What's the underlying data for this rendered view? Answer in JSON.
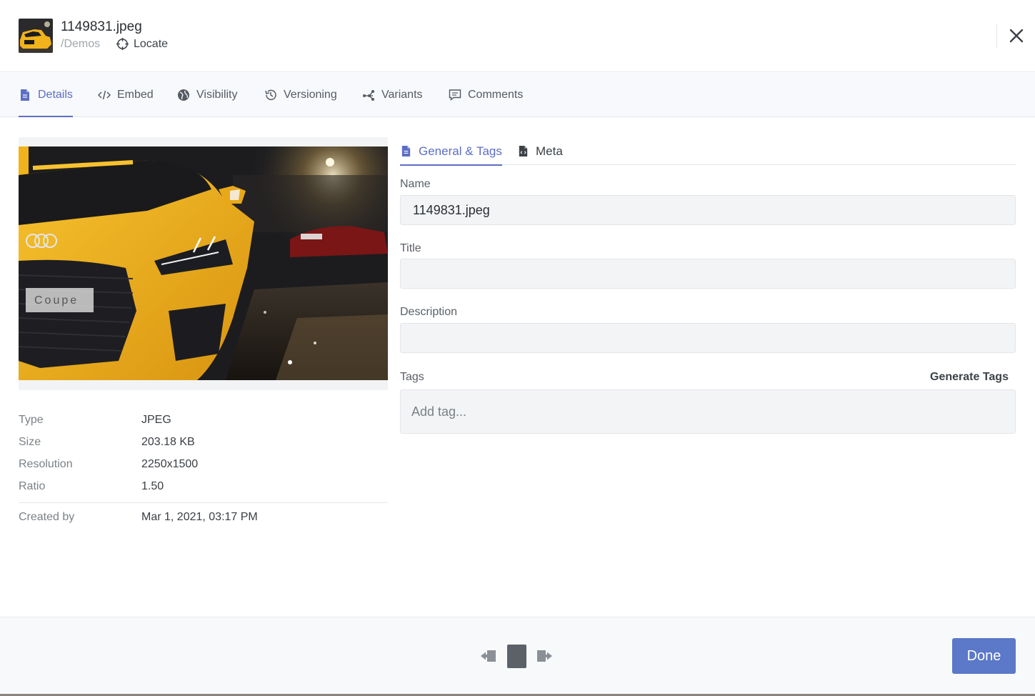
{
  "header": {
    "file_name": "1149831.jpeg",
    "folder_path": "/Demos",
    "locate_label": "Locate",
    "thumbnail_icon": "car-thumbnail",
    "close_icon": "close-icon"
  },
  "tabs": [
    {
      "label": "Details",
      "icon": "document-icon",
      "active": true
    },
    {
      "label": "Embed",
      "icon": "code-icon",
      "active": false
    },
    {
      "label": "Visibility",
      "icon": "globe-icon",
      "active": false
    },
    {
      "label": "Versioning",
      "icon": "history-icon",
      "active": false
    },
    {
      "label": "Variants",
      "icon": "variants-icon",
      "active": false
    },
    {
      "label": "Comments",
      "icon": "comment-icon",
      "active": false
    }
  ],
  "file_info": {
    "rows": [
      {
        "label": "Type",
        "value": "JPEG"
      },
      {
        "label": "Size",
        "value": "203.18 KB"
      },
      {
        "label": "Resolution",
        "value": "2250x1500"
      },
      {
        "label": "Ratio",
        "value": "1.50"
      }
    ],
    "created_label": "Created by",
    "created_value": "Mar 1, 2021, 03:17 PM"
  },
  "panel": {
    "subtabs": [
      {
        "label": "General & Tags",
        "icon": "document-icon",
        "active": true
      },
      {
        "label": "Meta",
        "icon": "code-file-icon",
        "active": false
      }
    ],
    "fields": {
      "name": {
        "label": "Name",
        "value": "1149831.jpeg"
      },
      "title": {
        "label": "Title",
        "value": ""
      },
      "description": {
        "label": "Description",
        "value": ""
      },
      "tags": {
        "label": "Tags",
        "placeholder": "Add tag..."
      }
    },
    "generate_tags_label": "Generate Tags"
  },
  "footer": {
    "done_label": "Done"
  },
  "colors": {
    "accent": "#5c6ec4",
    "done_button": "#5b78c9",
    "car_yellow": "#f2b21c"
  }
}
